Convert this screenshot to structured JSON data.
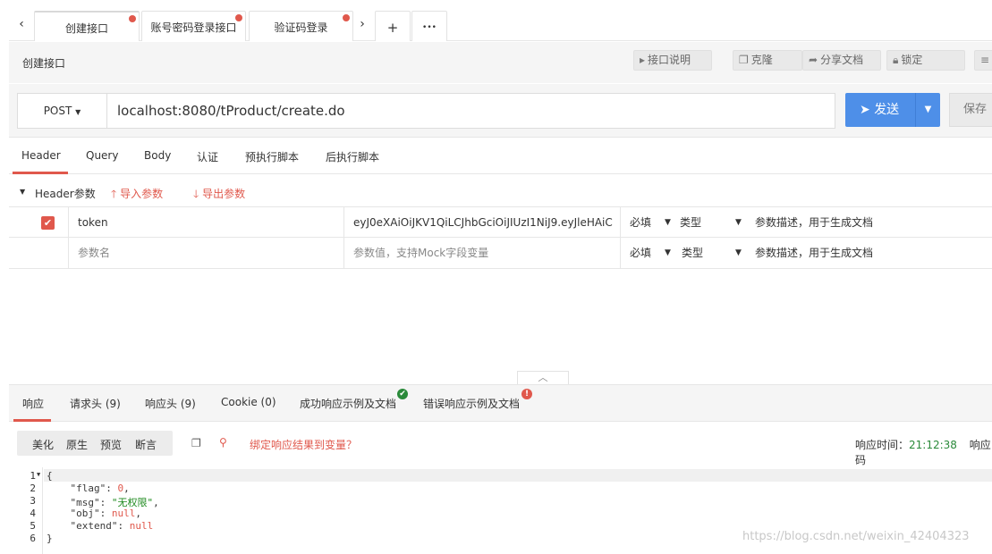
{
  "tabs": [
    {
      "label": "创建接口",
      "active": true
    },
    {
      "label": "账号密码登录接口",
      "active": false
    },
    {
      "label": "验证码登录",
      "active": false
    }
  ],
  "tab_tools": {
    "prev": "‹",
    "next": "›",
    "add": "+",
    "more": "•••"
  },
  "toolbar": {
    "title": "创建接口",
    "buttons": [
      "接口说明",
      "克隆",
      "分享文档",
      "锁定"
    ]
  },
  "request": {
    "method": "POST",
    "url": "localhost:8080/tProduct/create.do",
    "send_label": "发送",
    "save_label": "保存"
  },
  "req_tabs": [
    "Header",
    "Query",
    "Body",
    "认证",
    "预执行脚本",
    "后执行脚本"
  ],
  "header_section": {
    "label": "Header参数",
    "import": "导入参数",
    "export": "导出参数"
  },
  "params": [
    {
      "name": "token",
      "value": "eyJ0eXAiOiJKV1QiLCJhbGciOiJIUzI1NiJ9.eyJleHAiC",
      "required": "必填",
      "type": "类型",
      "desc": "参数描述，用于生成文档"
    },
    {
      "name": "参数名",
      "value": "参数值，支持Mock字段变量",
      "required": "必填",
      "type": "类型",
      "desc": "参数描述，用于生成文档"
    }
  ],
  "resp_tabs": [
    "响应",
    "请求头 (9)",
    "响应头 (9)",
    "Cookie (0)",
    "成功响应示例及文档",
    "错误响应示例及文档"
  ],
  "resp_view": [
    "美化",
    "原生",
    "预览",
    "断言"
  ],
  "bind_var": "绑定响应结果到变量？",
  "resp_time_label": "响应时间：",
  "resp_time_value": "21:12:38",
  "resp_code_label": "响应码",
  "code_lines": [
    "1",
    "2",
    "3",
    "4",
    "5",
    "6"
  ],
  "code": {
    "flag_key": "\"flag\"",
    "flag_val": "0",
    "msg_key": "\"msg\"",
    "msg_val": "\"无权限\"",
    "obj_key": "\"obj\"",
    "obj_val": "null",
    "extend_key": "\"extend\"",
    "extend_val": "null"
  },
  "watermark": "https://blog.csdn.net/weixin_42404323",
  "colors": {
    "accent": "#e0584c",
    "primary": "#4e8fe8",
    "success": "#2a8a3a"
  }
}
